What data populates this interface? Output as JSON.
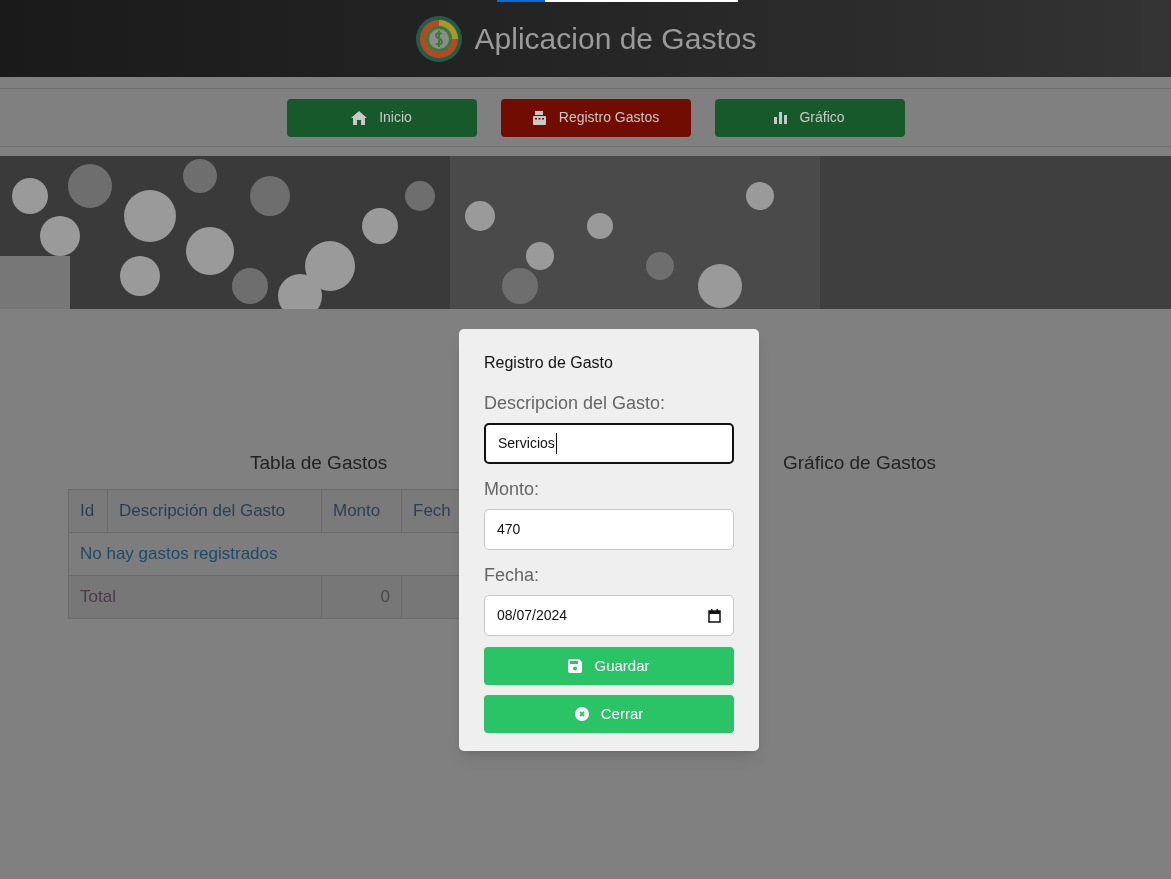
{
  "top_progress": {
    "level": 0.2
  },
  "header": {
    "title": "Aplicacion de Gastos"
  },
  "nav": [
    {
      "label": "Inicio",
      "kind": "home",
      "selected": false
    },
    {
      "label": "Registro Gastos",
      "kind": "register",
      "selected": true
    },
    {
      "label": "Gráfico",
      "kind": "chart",
      "selected": false
    }
  ],
  "table": {
    "title": "Tabla de Gastos",
    "columns": [
      "Id",
      "Descripción del Gasto",
      "Monto",
      "Fech"
    ],
    "empty_message": "No hay gastos registrados",
    "total_label": "Total",
    "total_value": "0"
  },
  "chart_panel": {
    "title": "Gráfico de Gastos"
  },
  "modal": {
    "title": "Registro de Gasto",
    "fields": [
      {
        "label": "Descripcion del Gasto:",
        "value": "Servicios",
        "kind": "text",
        "focused": true
      },
      {
        "label": "Monto:",
        "value": "470",
        "kind": "text",
        "focused": false
      },
      {
        "label": "Fecha:",
        "value": "08/07/2024",
        "kind": "date",
        "focused": false
      }
    ],
    "buttons": [
      {
        "label": "Guardar",
        "kind": "save"
      },
      {
        "label": "Cerrar",
        "kind": "close"
      }
    ]
  }
}
